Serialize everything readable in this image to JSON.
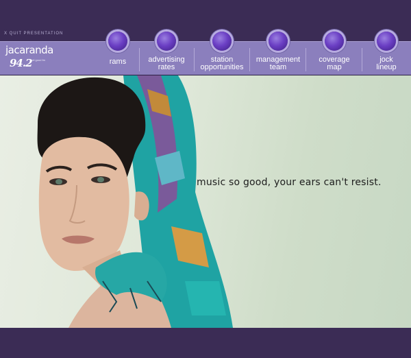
{
  "quit_label": "X QUIT PRESENTATION",
  "logo": {
    "word": "jacaranda",
    "frequency": "94.2",
    "tagline": "feel good fm"
  },
  "nav": {
    "items": [
      {
        "label_line1": "rams",
        "label_line2": ""
      },
      {
        "label_line1": "advertising",
        "label_line2": "rates"
      },
      {
        "label_line1": "station",
        "label_line2": "opportunities"
      },
      {
        "label_line1": "management",
        "label_line2": "team"
      },
      {
        "label_line1": "coverage",
        "label_line2": "map"
      },
      {
        "label_line1": "jock",
        "label_line2": "lineup"
      }
    ]
  },
  "hero": {
    "tagline": "music so good, your ears can't resist."
  },
  "colors": {
    "frame": "#3b2c55",
    "navbar": "#8b7fbd",
    "orb": "#6b3fc4",
    "hero_bg": "#dfe8d9"
  }
}
